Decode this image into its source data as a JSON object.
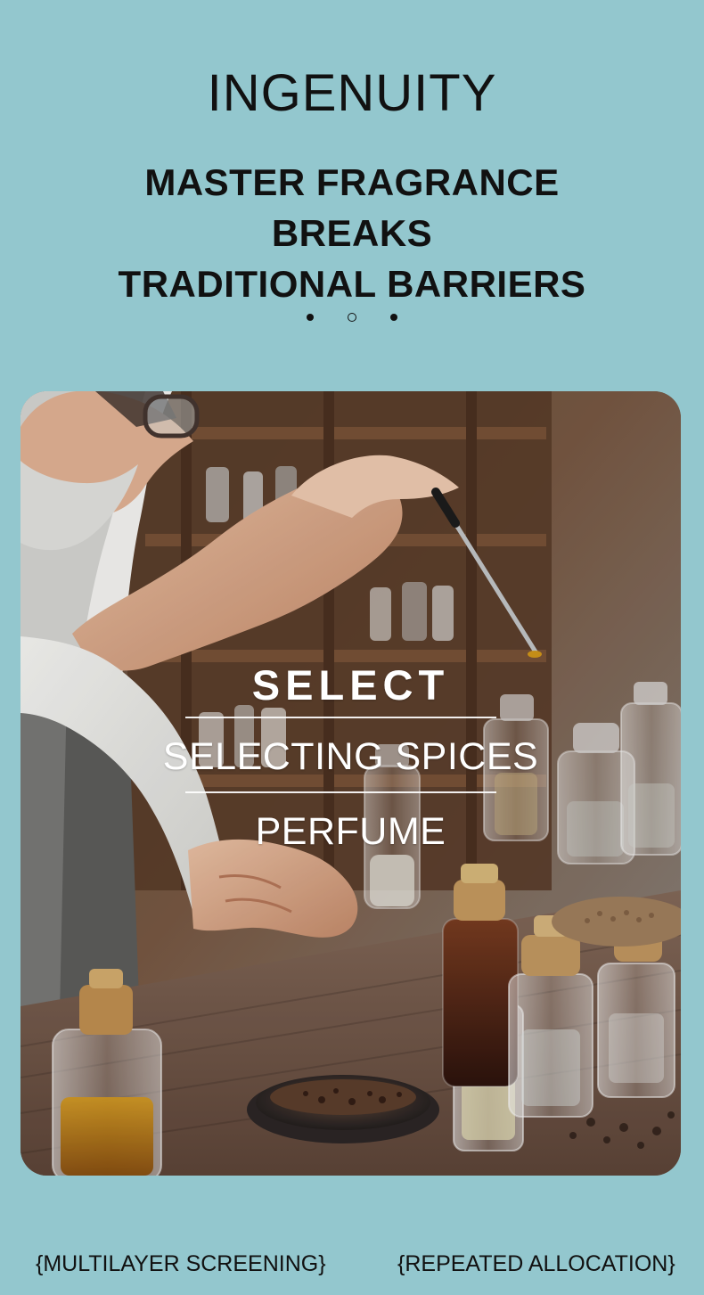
{
  "header": {
    "title": "INGENUITY",
    "subtitle_line_1": "MASTER FRAGRANCE BREAKS",
    "subtitle_line_2": "TRADITIONAL BARRIERS"
  },
  "carousel": {
    "dot_count": 3,
    "active_index": 1
  },
  "hero_overlay": {
    "title": "SELECT",
    "line_1": "SELECTING SPICES",
    "line_2": "PERFUME"
  },
  "footer": {
    "left": "{MULTILAYER SCREENING}",
    "right": "{REPEATED ALLOCATION}"
  },
  "colors": {
    "background": "#93c7ce",
    "text": "#111111",
    "overlay_text": "#ffffff"
  },
  "icons": {
    "carousel_indicator": "dot-indicator-icon"
  }
}
